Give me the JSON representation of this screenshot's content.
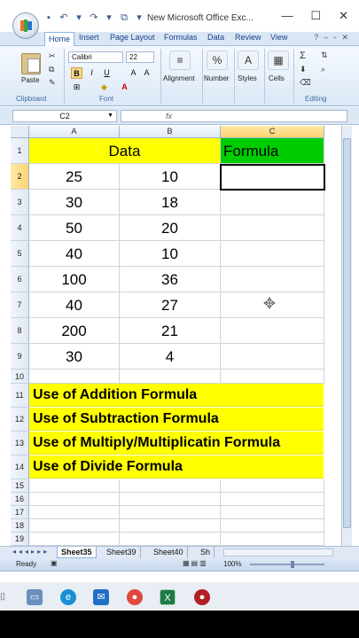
{
  "window": {
    "title": "New Microsoft Office Exc...",
    "minimize": "—",
    "maximize": "☐",
    "close": "✕"
  },
  "ribbon": {
    "tabs": [
      "Home",
      "Insert",
      "Page Layout",
      "Formulas",
      "Data",
      "Review",
      "View"
    ],
    "font_name": "Calibri",
    "font_size": "22",
    "paste_label": "Paste",
    "groups": {
      "clipboard": "Clipboard",
      "font": "Font",
      "alignment": "Alignment",
      "number": "Number",
      "styles": "Styles",
      "cells": "Cells",
      "editing": "Editing"
    }
  },
  "formula_bar": {
    "name_box": "C2",
    "fx": "fx",
    "content": ""
  },
  "grid": {
    "columns": [
      "A",
      "B",
      "C"
    ],
    "rows": [
      "1",
      "2",
      "3",
      "4",
      "5",
      "6",
      "7",
      "8",
      "9",
      "10",
      "11",
      "12",
      "13",
      "14",
      "15",
      "16",
      "17",
      "18",
      "19"
    ],
    "header": {
      "a": "Data",
      "c": "Formula"
    },
    "data": [
      [
        "25",
        "10"
      ],
      [
        "30",
        "18"
      ],
      [
        "50",
        "20"
      ],
      [
        "40",
        "10"
      ],
      [
        "100",
        "36"
      ],
      [
        "40",
        "27"
      ],
      [
        "200",
        "21"
      ],
      [
        "30",
        "4"
      ]
    ],
    "notes": [
      "Use of Addition Formula",
      "Use of Subtraction Formula",
      "Use of Multiply/Multiplicatin Formula",
      "Use of Divide Formula"
    ]
  },
  "sheets": {
    "tabs": [
      "Sheet35",
      "Sheet39",
      "Sheet40",
      "Sh"
    ],
    "active": "Sheet35"
  },
  "status": {
    "ready": "Ready",
    "zoom": "100%"
  },
  "colors": {
    "yellow": "#ffff00",
    "green": "#00cc00",
    "selection_header": "#fbd271"
  }
}
